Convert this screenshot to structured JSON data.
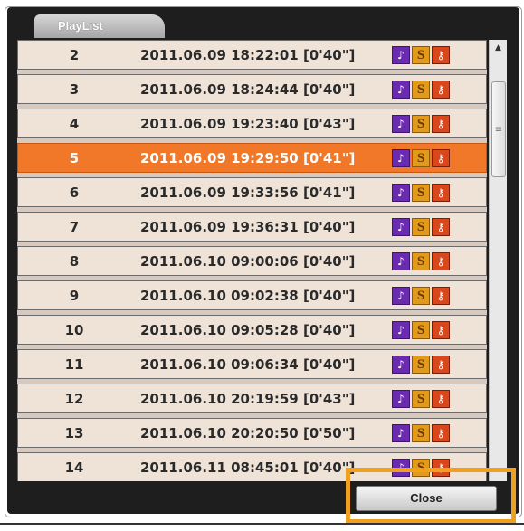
{
  "tab": {
    "label": "PlayList"
  },
  "rows": [
    {
      "num": "2",
      "datetime": "2011.06.09 18:22:01 [0'40\"]",
      "selected": false
    },
    {
      "num": "3",
      "datetime": "2011.06.09 18:24:44 [0'40\"]",
      "selected": false
    },
    {
      "num": "4",
      "datetime": "2011.06.09 19:23:40 [0'43\"]",
      "selected": false
    },
    {
      "num": "5",
      "datetime": "2011.06.09 19:29:50 [0'41\"]",
      "selected": true
    },
    {
      "num": "6",
      "datetime": "2011.06.09 19:33:56 [0'41\"]",
      "selected": false
    },
    {
      "num": "7",
      "datetime": "2011.06.09 19:36:31 [0'40\"]",
      "selected": false
    },
    {
      "num": "8",
      "datetime": "2011.06.10 09:00:06 [0'40\"]",
      "selected": false
    },
    {
      "num": "9",
      "datetime": "2011.06.10 09:02:38 [0'40\"]",
      "selected": false
    },
    {
      "num": "10",
      "datetime": "2011.06.10 09:05:28 [0'40\"]",
      "selected": false
    },
    {
      "num": "11",
      "datetime": "2011.06.10 09:06:34 [0'40\"]",
      "selected": false
    },
    {
      "num": "12",
      "datetime": "2011.06.10 20:19:59 [0'43\"]",
      "selected": false
    },
    {
      "num": "13",
      "datetime": "2011.06.10 20:20:50 [0'50\"]",
      "selected": false
    },
    {
      "num": "14",
      "datetime": "2011.06.11 08:45:01 [0'40\"]",
      "selected": false
    }
  ],
  "row_icons": {
    "music": {
      "name": "music-note-icon",
      "glyph": "♪",
      "color": "#6a2bb0"
    },
    "s": {
      "name": "s-badge-icon",
      "glyph": "S",
      "color": "#e39a1a"
    },
    "key": {
      "name": "key-icon",
      "glyph": "⚷",
      "color": "#d8481c"
    }
  },
  "scrollbar": {
    "up_glyph": "▲",
    "grip_glyph": "≡"
  },
  "buttons": {
    "close_label": "Close"
  },
  "colors": {
    "selected_row": "#f07828",
    "row_bg": "#efe2d6",
    "frame_bg": "#1e1e1e",
    "highlight": "#f0a020"
  }
}
